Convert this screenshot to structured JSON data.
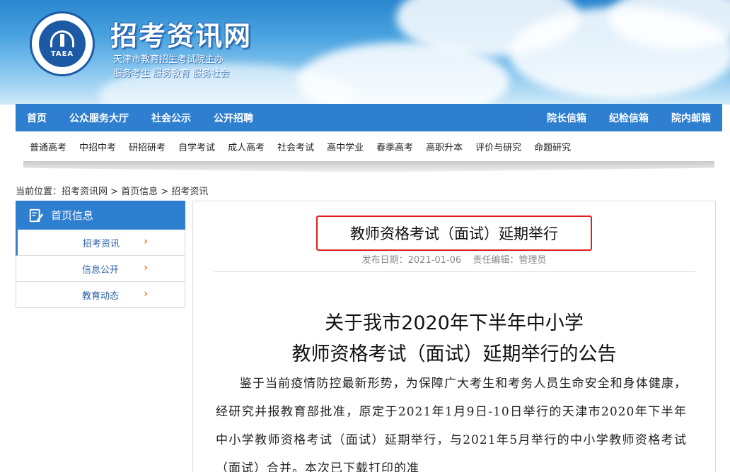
{
  "header": {
    "site_title": "招考资讯网",
    "subtitle_line1": "天津市教育招生考试院主办",
    "subtitle_line2": "服务考生 服务教育 服务社会",
    "logo_text": "TAEA"
  },
  "main_nav": {
    "left": [
      "首页",
      "公众服务大厅",
      "社会公示",
      "公开招聘"
    ],
    "right": [
      "院长信箱",
      "纪检信箱",
      "院内邮箱"
    ]
  },
  "sub_nav": [
    "普通高考",
    "中招中考",
    "研招研考",
    "自学考试",
    "成人高考",
    "社会考试",
    "高中学业",
    "春季高考",
    "高职升本",
    "评价与研究",
    "命题研究"
  ],
  "breadcrumb": "当前位置：招考资讯网 > 首页信息 > 招考资讯",
  "sidebar": {
    "title": "首页信息",
    "items": [
      {
        "label": "招考资讯",
        "active": true
      },
      {
        "label": "信息公开",
        "active": false
      },
      {
        "label": "教育动态",
        "active": false
      }
    ]
  },
  "article": {
    "title": "教师资格考试（面试）延期举行",
    "publish_date": "发布日期：2021-01-06",
    "editor": "责任编辑：管理员",
    "heading_line1": "关于我市2020年下半年中小学",
    "heading_line2": "教师资格考试（面试）延期举行的公告",
    "body": "鉴于当前疫情防控最新形势，为保障广大考生和考务人员生命安全和身体健康，经研究并报教育部批准，原定于2021年1月9日-10日举行的天津市2020年下半年中小学教师资格考试（面试）延期举行，与2021年5月举行的中小学教师资格考试（面试）合并。本次已下载打印的准"
  },
  "colors": {
    "nav_blue": "#2f7fd0",
    "highlight_red": "#e02020",
    "chevron_orange": "#e07b12"
  }
}
